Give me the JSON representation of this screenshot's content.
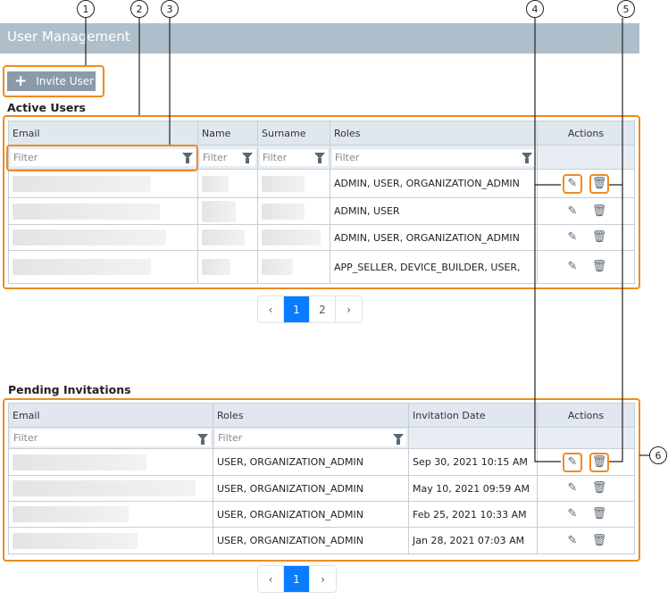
{
  "header": {
    "title": "User Management"
  },
  "invite_button": {
    "label": "Invite User",
    "icon": "plus-icon"
  },
  "active_users": {
    "title": "Active Users",
    "columns": [
      "Email",
      "Name",
      "Surname",
      "Roles",
      "Actions"
    ],
    "filter_placeholder": "Filter",
    "rows": [
      {
        "roles": "ADMIN, USER, ORGANIZATION_ADMIN"
      },
      {
        "roles": "ADMIN, USER"
      },
      {
        "roles": "ADMIN, USER, ORGANIZATION_ADMIN"
      },
      {
        "roles": "APP_SELLER, DEVICE_BUILDER, USER,"
      }
    ],
    "pagination": {
      "prev": "‹",
      "pages": [
        "1",
        "2"
      ],
      "current": "1",
      "next": "›"
    }
  },
  "pending_invitations": {
    "title": "Pending Invitations",
    "columns": [
      "Email",
      "Roles",
      "Invitation Date",
      "Actions"
    ],
    "filter_placeholder": "Filter",
    "rows": [
      {
        "roles": "USER, ORGANIZATION_ADMIN",
        "date": "Sep 30, 2021 10:15 AM"
      },
      {
        "roles": "USER, ORGANIZATION_ADMIN",
        "date": "May 10, 2021 09:59 AM"
      },
      {
        "roles": "USER, ORGANIZATION_ADMIN",
        "date": "Feb 25, 2021 10:33 AM"
      },
      {
        "roles": "USER, ORGANIZATION_ADMIN",
        "date": "Jan 28, 2021 07:03 AM"
      }
    ],
    "pagination": {
      "prev": "‹",
      "pages": [
        "1"
      ],
      "current": "1",
      "next": "›"
    }
  },
  "callouts": [
    "1",
    "2",
    "3",
    "4",
    "5",
    "6"
  ],
  "colors": {
    "highlight": "#f08a24",
    "header": "#aebfcb",
    "active_page": "#0a7cff"
  }
}
